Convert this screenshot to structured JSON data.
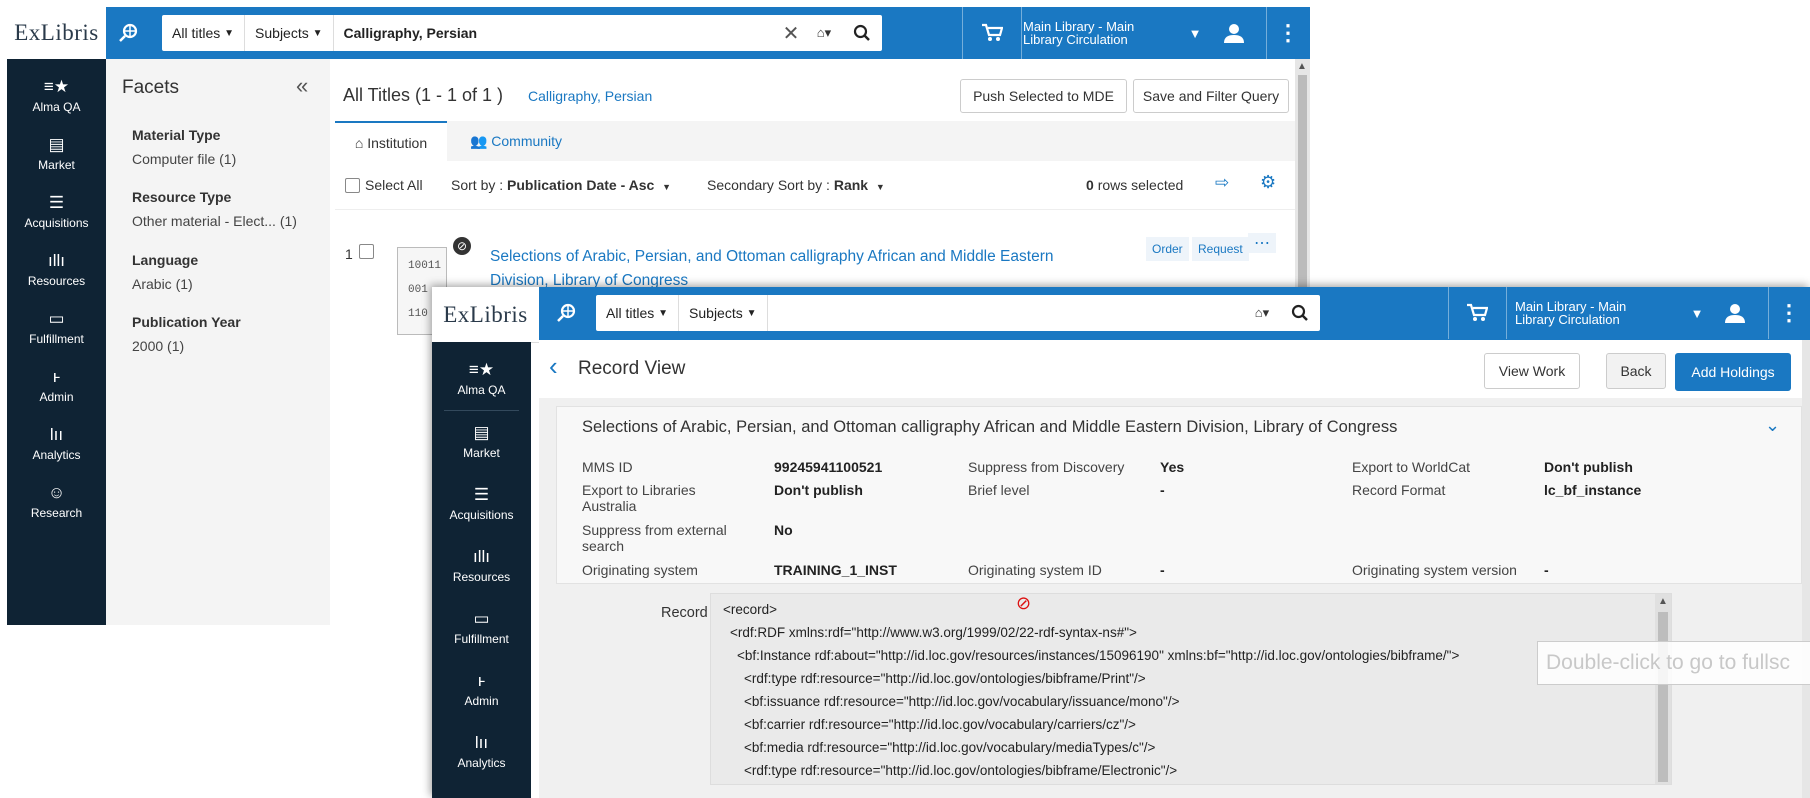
{
  "window1": {
    "logo": "ExLibris",
    "search": {
      "scope": "All titles",
      "type": "Subjects",
      "query": "Calligraphy, Persian"
    },
    "library": "Main Library - Main Library Circulation",
    "nav": [
      {
        "label": "Alma QA",
        "icon": "alma-star-icon"
      },
      {
        "label": "Market",
        "icon": "market-icon"
      },
      {
        "label": "Acquisitions",
        "icon": "acquisitions-icon"
      },
      {
        "label": "Resources",
        "icon": "resources-icon"
      },
      {
        "label": "Fulfillment",
        "icon": "fulfillment-icon"
      },
      {
        "label": "Admin",
        "icon": "admin-icon"
      },
      {
        "label": "Analytics",
        "icon": "analytics-icon"
      },
      {
        "label": "Research",
        "icon": "research-icon"
      }
    ],
    "facets": {
      "title": "Facets",
      "groups": [
        {
          "title": "Material Type",
          "value": "Computer file (1)"
        },
        {
          "title": "Resource Type",
          "value": "Other material - Elect... (1)"
        },
        {
          "title": "Language",
          "value": "Arabic (1)"
        },
        {
          "title": "Publication Year",
          "value": "2000 (1)"
        }
      ]
    },
    "results": {
      "heading": "All Titles (1 - 1 of 1 )",
      "query_link": "Calligraphy, Persian",
      "push_button": "Push Selected to MDE",
      "save_button": "Save and Filter Query",
      "tab_institution": "Institution",
      "tab_community": "Community",
      "select_all": "Select All",
      "sort_label": "Sort by :",
      "sort_value": "Publication Date - Asc",
      "secondary_sort_label": "Secondary Sort by :",
      "secondary_sort_value": "Rank",
      "rows_count": "0",
      "rows_selected": "rows selected",
      "item_number": "1",
      "item_title": "Selections of Arabic, Persian, and Ottoman calligraphy African and Middle Eastern",
      "item_title_2": "Division, Library of Congress",
      "order": "Order",
      "request": "Request",
      "thumb_lines": [
        "10011",
        "001",
        "110"
      ]
    }
  },
  "window2": {
    "logo": "ExLibris",
    "search": {
      "scope": "All titles",
      "type": "Subjects"
    },
    "library": "Main Library - Main Library Circulation",
    "nav": [
      {
        "label": "Alma QA"
      },
      {
        "label": "Market"
      },
      {
        "label": "Acquisitions"
      },
      {
        "label": "Resources"
      },
      {
        "label": "Fulfillment"
      },
      {
        "label": "Admin"
      },
      {
        "label": "Analytics"
      }
    ],
    "page_title": "Record View",
    "view_work": "View Work",
    "back": "Back",
    "add_holdings": "Add Holdings",
    "record_title": "Selections of Arabic, Persian, and Ottoman calligraphy African and Middle Eastern Division, Library of Congress",
    "meta": {
      "mms_id_label": "MMS ID",
      "mms_id": "99245941100521",
      "suppress_discovery_label": "Suppress from Discovery",
      "suppress_discovery": "Yes",
      "export_worldcat_label": "Export to WorldCat",
      "export_worldcat": "Don't publish",
      "export_libraries_label_1": "Export to Libraries",
      "export_libraries_label_2": "Australia",
      "export_libraries": "Don't publish",
      "brief_level_label": "Brief level",
      "brief_level": "-",
      "record_format_label": "Record Format",
      "record_format": "lc_bf_instance",
      "suppress_external_label_1": "Suppress from external",
      "suppress_external_label_2": "search",
      "suppress_external": "No",
      "orig_system_label": "Originating system",
      "orig_system": "TRAINING_1_INST",
      "orig_system_id_label": "Originating system ID",
      "orig_system_id": "-",
      "orig_system_version_label": "Originating system version",
      "orig_system_version": "-"
    },
    "record_label": "Record",
    "xml": [
      "<record>",
      "<rdf:RDF xmlns:rdf=\"http://www.w3.org/1999/02/22-rdf-syntax-ns#\">",
      "<bf:Instance rdf:about=\"http://id.loc.gov/resources/instances/15096190\" xmlns:bf=\"http://id.loc.gov/ontologies/bibframe/\">",
      "<rdf:type rdf:resource=\"http://id.loc.gov/ontologies/bibframe/Print\"/>",
      "<bf:issuance rdf:resource=\"http://id.loc.gov/vocabulary/issuance/mono\"/>",
      "<bf:carrier rdf:resource=\"http://id.loc.gov/vocabulary/carriers/cz\"/>",
      "<bf:media rdf:resource=\"http://id.loc.gov/vocabulary/mediaTypes/c\"/>",
      "<rdf:type rdf:resource=\"http://id.loc.gov/ontologies/bibframe/Electronic\"/>"
    ]
  },
  "overlay_hint": "Double-click to go to fullsc",
  "colors": {
    "brand_blue": "#1a78c2",
    "nav_dark": "#0f2334",
    "link": "#1a78c2"
  }
}
